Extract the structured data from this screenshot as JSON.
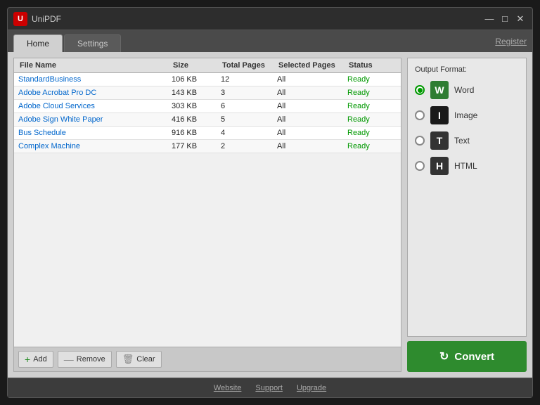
{
  "window": {
    "logo": "U",
    "title": "UniPDF",
    "min_btn": "—",
    "max_btn": "□",
    "close_btn": "✕"
  },
  "tabs": [
    {
      "id": "home",
      "label": "Home",
      "active": true
    },
    {
      "id": "settings",
      "label": "Settings",
      "active": false
    }
  ],
  "register_label": "Register",
  "table": {
    "headers": [
      "File Name",
      "Size",
      "Total Pages",
      "Selected Pages",
      "Status"
    ],
    "rows": [
      {
        "name": "StandardBusiness",
        "size": "106 KB",
        "total": "12",
        "selected": "All",
        "status": "Ready"
      },
      {
        "name": "Adobe Acrobat Pro DC",
        "size": "143 KB",
        "total": "3",
        "selected": "All",
        "status": "Ready"
      },
      {
        "name": "Adobe Cloud Services",
        "size": "303 KB",
        "total": "6",
        "selected": "All",
        "status": "Ready"
      },
      {
        "name": "Adobe Sign White Paper",
        "size": "416 KB",
        "total": "5",
        "selected": "All",
        "status": "Ready"
      },
      {
        "name": "Bus Schedule",
        "size": "916 KB",
        "total": "4",
        "selected": "All",
        "status": "Ready"
      },
      {
        "name": "Complex Machine",
        "size": "177 KB",
        "total": "2",
        "selected": "All",
        "status": "Ready"
      }
    ]
  },
  "toolbar": {
    "add_label": "Add",
    "remove_label": "Remove",
    "clear_label": "Clear"
  },
  "output_format": {
    "title": "Output Format:",
    "options": [
      {
        "id": "word",
        "label": "Word",
        "icon": "W",
        "icon_class": "word",
        "selected": true
      },
      {
        "id": "image",
        "label": "Image",
        "icon": "I",
        "icon_class": "image",
        "selected": false
      },
      {
        "id": "text",
        "label": "Text",
        "icon": "T",
        "icon_class": "text",
        "selected": false
      },
      {
        "id": "html",
        "label": "HTML",
        "icon": "H",
        "icon_class": "html",
        "selected": false
      }
    ]
  },
  "convert_label": "Convert",
  "footer": {
    "website": "Website",
    "support": "Support",
    "upgrade": "Upgrade"
  }
}
